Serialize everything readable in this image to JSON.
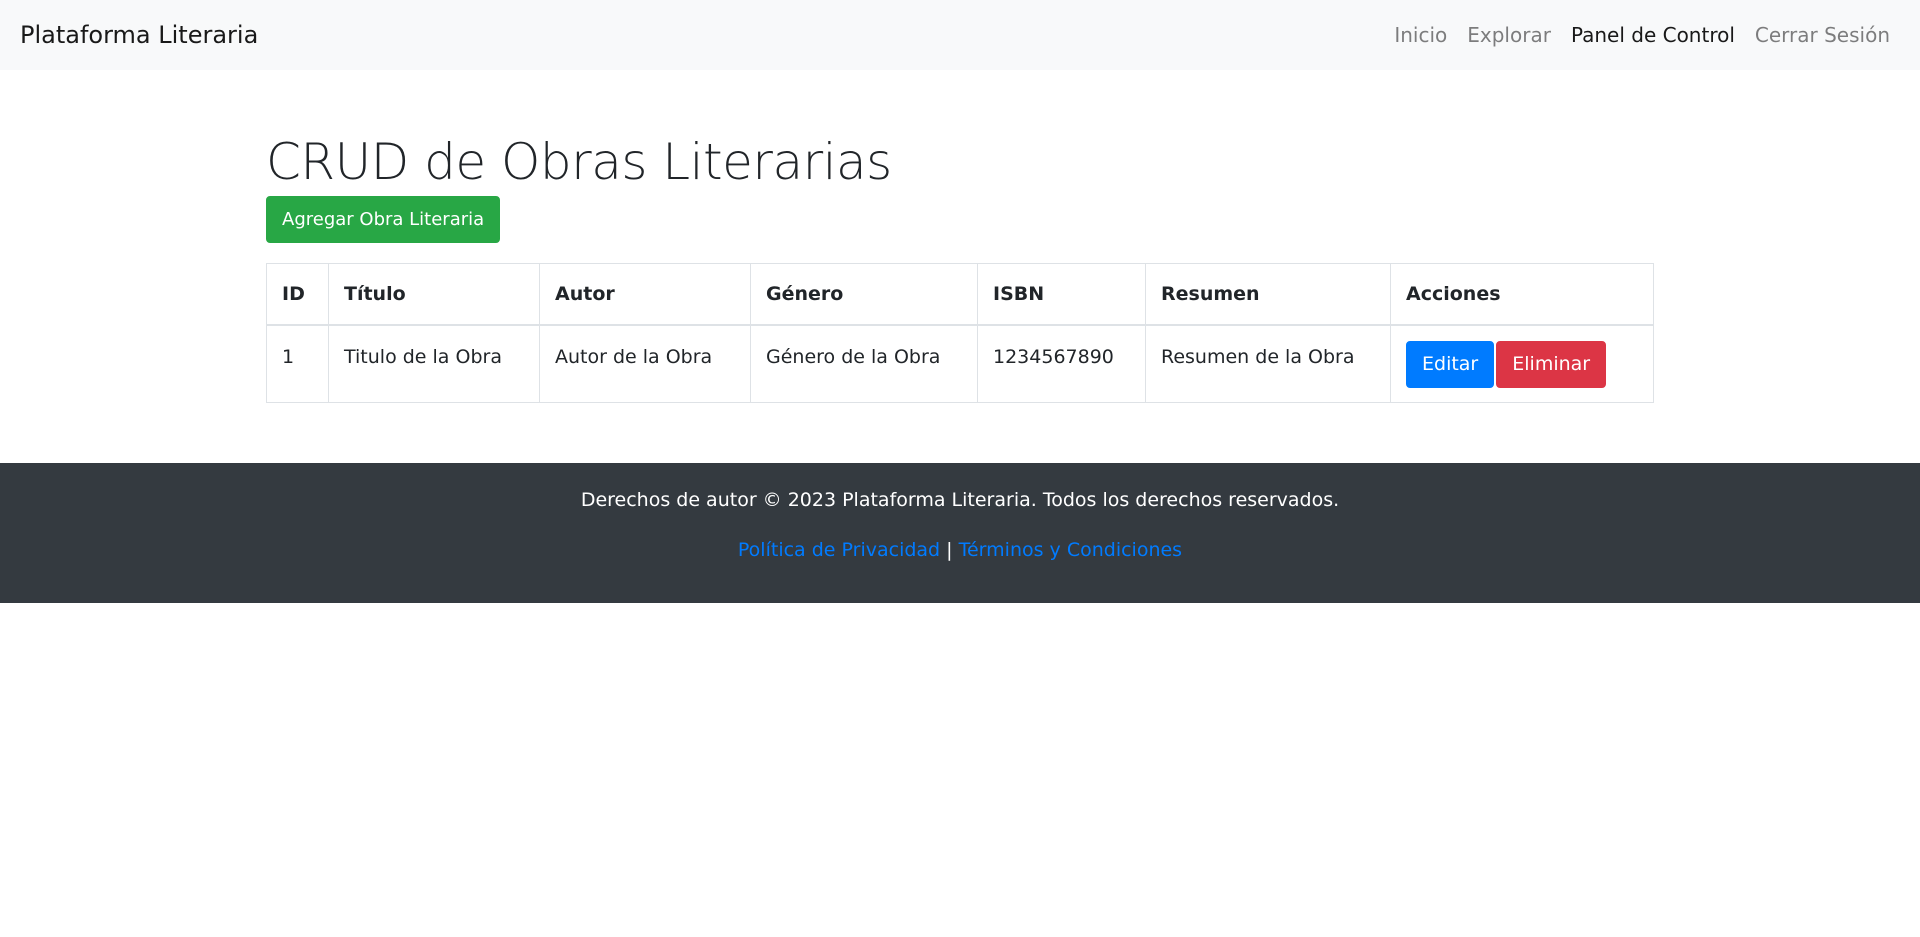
{
  "navbar": {
    "brand": "Plataforma Literaria",
    "links": [
      {
        "label": "Inicio",
        "active": false
      },
      {
        "label": "Explorar",
        "active": false
      },
      {
        "label": "Panel de Control",
        "active": true
      },
      {
        "label": "Cerrar Sesión",
        "active": false
      }
    ]
  },
  "main": {
    "title": "CRUD de Obras Literarias",
    "add_button": "Agregar Obra Literaria",
    "table": {
      "headers": [
        "ID",
        "Título",
        "Autor",
        "Género",
        "ISBN",
        "Resumen",
        "Acciones"
      ],
      "rows": [
        {
          "id": "1",
          "titulo": "Titulo de la Obra",
          "autor": "Autor de la Obra",
          "genero": "Género de la Obra",
          "isbn": "1234567890",
          "resumen": "Resumen de la Obra",
          "edit_label": "Editar",
          "delete_label": "Eliminar"
        }
      ]
    }
  },
  "footer": {
    "copyright": "Derechos de autor © 2023 Plataforma Literaria. Todos los derechos reservados.",
    "privacy_link": "Política de Privacidad",
    "separator": "|",
    "terms_link": "Términos y Condiciones"
  },
  "colors": {
    "success": "#28a745",
    "primary": "#007bff",
    "danger": "#dc3545",
    "footer_bg": "#343a40",
    "navbar_bg": "#f8f9fa"
  }
}
